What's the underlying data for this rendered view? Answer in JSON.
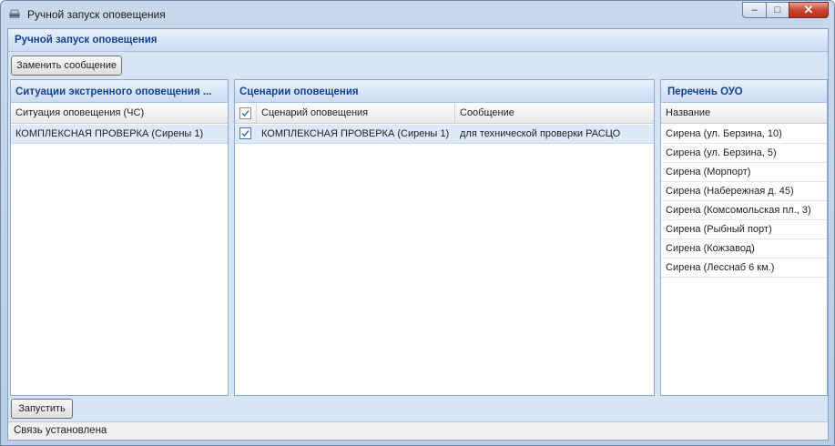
{
  "window": {
    "title": "Ручной запуск оповещения",
    "controls": {
      "minimize": "–",
      "maximize": "□",
      "close": "✕"
    }
  },
  "header": {
    "title": "Ручной запуск оповещения"
  },
  "toolbar": {
    "replace_message_label": "Заменить сообщение"
  },
  "situations": {
    "title": "Ситуации экстренного оповещения ...",
    "column": "Ситуация оповещения (ЧС)",
    "rows": [
      "КОМПЛЕКСНАЯ ПРОВЕРКА (Сирены 1)"
    ]
  },
  "scenarios": {
    "title": "Сценарии оповещения",
    "columns": {
      "checkbox_checked": true,
      "scenario": "Сценарий оповещения",
      "message": "Сообщение"
    },
    "rows": [
      {
        "checked": true,
        "scenario": "КОМПЛЕКСНАЯ ПРОВЕРКА (Сирены 1)",
        "message": "для технической проверки РАСЦО"
      }
    ]
  },
  "ouo": {
    "title": "Перечень ОУО",
    "column": "Название",
    "rows": [
      "Сирена (ул. Берзина, 10)",
      "Сирена (ул. Берзина, 5)",
      "Сирена (Морпорт)",
      "Сирена (Набережная д. 45)",
      "Сирена (Комсомольская пл., 3)",
      "Сирена (Рыбный порт)",
      "Сирена (Кожзавод)",
      "Сирена (Лесснаб 6 км.)"
    ]
  },
  "footer": {
    "run_label": "Запустить"
  },
  "status": {
    "text": "Связь установлена"
  },
  "colors": {
    "header_text": "#15428b",
    "selected_row": "#dde9f7",
    "accent": "#3c7fb1"
  }
}
